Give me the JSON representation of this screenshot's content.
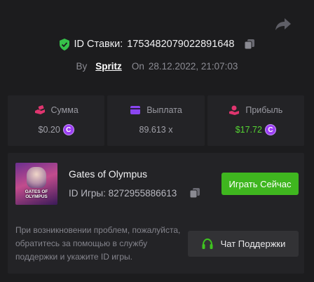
{
  "bet": {
    "id_label": "ID Ставки:",
    "id_value": "1753482079022891648",
    "by_label": "By",
    "username": "Spritz",
    "on_label": "On",
    "datetime": "28.12.2022, 21:07:03"
  },
  "stats": [
    {
      "label": "Сумма",
      "value": "$0.20",
      "icon": "money-hand-icon",
      "color": "#e0356f",
      "coin": true
    },
    {
      "label": "Выплата",
      "value": "89.613 x",
      "icon": "wallet-card-icon",
      "color": "#8a45f0",
      "coin": false
    },
    {
      "label": "Прибыль",
      "value": "$17.72",
      "icon": "profit-hand-icon",
      "color": "#e0356f",
      "coin": true,
      "value_color": "#55d433"
    }
  ],
  "game": {
    "name": "Gates of Olympus",
    "thumb_title": "GATES OF OLYMPUS",
    "id_label": "ID Игры:",
    "id_value": "8272955886613",
    "play_label": "Играть Сейчас"
  },
  "support": {
    "help_text": "При возникновении проблем, пожалуйста, обратитесь за помощью в службу поддержки и укажите ID игры.",
    "button_label": "Чат Поддержки"
  },
  "coin_symbol": "C",
  "colors": {
    "accent_green": "#3fb61f",
    "background": "#1c1c1e",
    "card": "#232326"
  }
}
